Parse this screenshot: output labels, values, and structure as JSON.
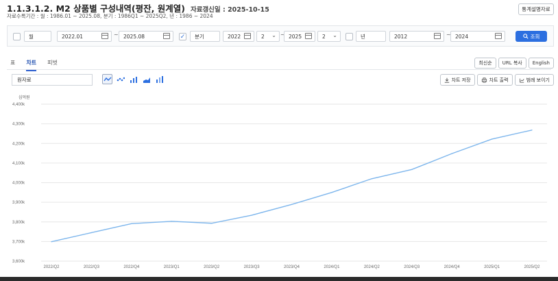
{
  "header": {
    "title": "1.1.3.1.2. M2 상품별 구성내역(평잔, 원계열)",
    "updated": "자료갱신일 : 2025-10-15",
    "period": "자료수록기간 : 월 : 1986.01 ~ 2025.08, 분기 : 1986Q1 ~ 2025Q2, 년 : 1986 ~ 2024",
    "stat_button": "통계설명자료"
  },
  "filters": {
    "monthly": {
      "checked": false,
      "label": "월",
      "from": "2022.01",
      "to": "2025.08"
    },
    "quarterly": {
      "checked": true,
      "label": "분기",
      "from_year": "2022",
      "from_q": "2",
      "to_year": "2025",
      "to_q": "2"
    },
    "yearly": {
      "checked": false,
      "label": "년",
      "from": "2012",
      "to": "2024"
    },
    "separator": "~",
    "search_label": "조회"
  },
  "tabs": [
    {
      "label": "표",
      "active": false
    },
    {
      "label": "차트",
      "active": true
    },
    {
      "label": "피벗",
      "active": false
    }
  ],
  "top_buttons": [
    "최신순",
    "URL 복사",
    "English"
  ],
  "series_select": "원자료",
  "chart_type_icons": [
    "line-chart-icon",
    "scatter-chart-icon",
    "bar-chart-icon",
    "area-chart-icon",
    "stacked-bar-chart-icon"
  ],
  "chart_actions": [
    {
      "label": "차트 저장",
      "icon": "download-icon"
    },
    {
      "label": "차트 출력",
      "icon": "print-icon"
    },
    {
      "label": "범례 보이기",
      "icon": "legend-icon"
    }
  ],
  "colors": {
    "accent": "#2c6fe0",
    "line": "#7cb5ec"
  },
  "chart_data": {
    "type": "line",
    "unit": "십억원",
    "categories": [
      "2022/Q2",
      "2022/Q3",
      "2022/Q4",
      "2023/Q1",
      "2023/Q2",
      "2023/Q3",
      "2023/Q4",
      "2024/Q1",
      "2024/Q2",
      "2024/Q3",
      "2024/Q4",
      "2025/Q1",
      "2025/Q2"
    ],
    "series": [
      {
        "values": [
          3699,
          3745,
          3791,
          3803,
          3793,
          3834,
          3889,
          3950,
          4020,
          4067,
          4148,
          4222,
          4268
        ]
      }
    ],
    "ylim": [
      3600,
      4400
    ],
    "yticks": [
      3600,
      3700,
      3800,
      3900,
      4000,
      4100,
      4200,
      4300,
      4400
    ],
    "ytick_labels": [
      "3,600k",
      "3,700k",
      "3,800k",
      "3,900k",
      "4,000k",
      "4,100k",
      "4,200k",
      "4,300k",
      "4,400k"
    ],
    "grid": true
  }
}
